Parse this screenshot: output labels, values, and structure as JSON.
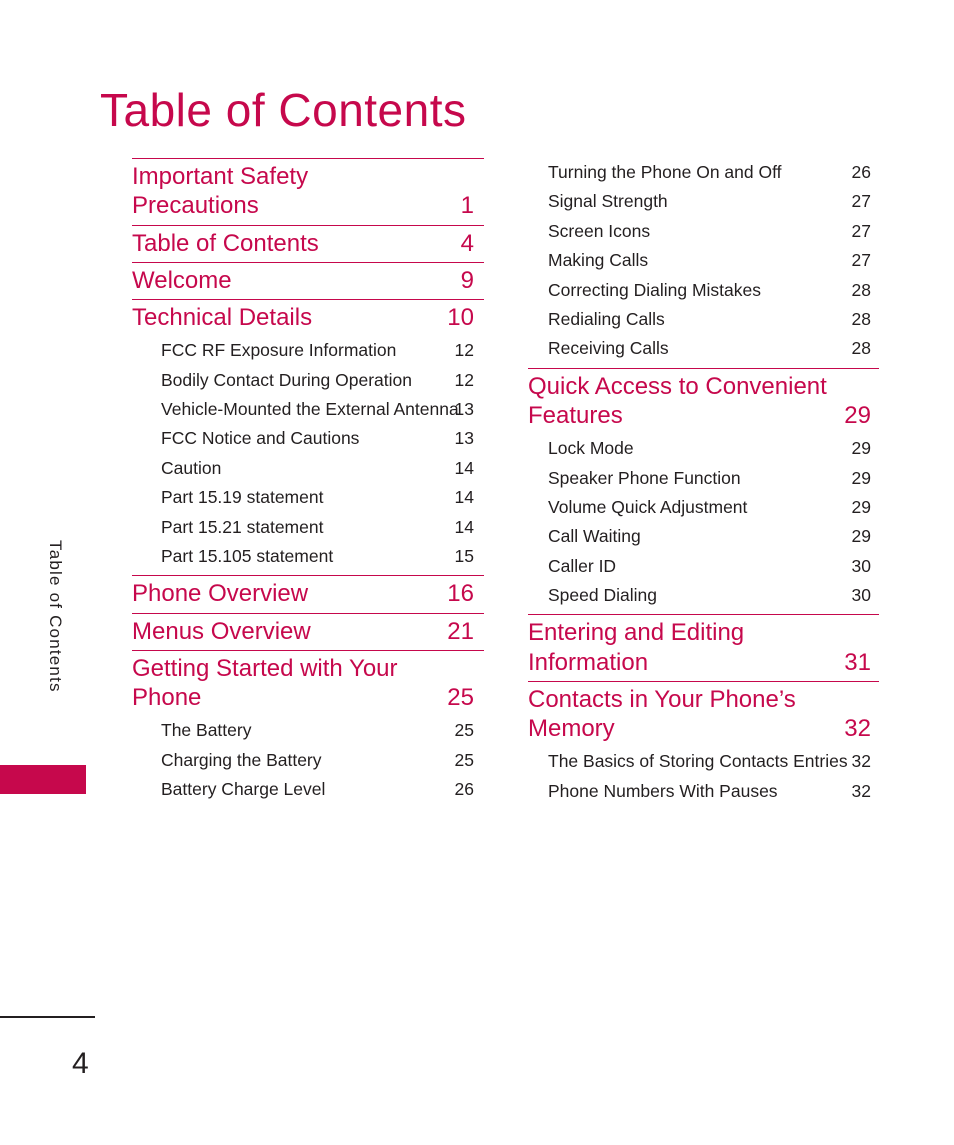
{
  "document": {
    "title": "Table of Contents",
    "page_number": "4",
    "side_tab_label": "Table of Contents",
    "accent_color": "#c6084c",
    "text_color": "#231f20"
  },
  "columns": [
    {
      "id": "left",
      "blocks": [
        {
          "kind": "major",
          "label": "Important Safety Precautions",
          "page": "1"
        },
        {
          "kind": "major",
          "label": "Table of Contents",
          "page": "4"
        },
        {
          "kind": "major",
          "label": "Welcome",
          "page": "9"
        },
        {
          "kind": "major",
          "label": "Technical Details",
          "page": "10"
        },
        {
          "kind": "sub-group",
          "items": [
            {
              "label": "FCC RF Exposure Information",
              "page": "12"
            },
            {
              "label": "Bodily Contact During Operation",
              "page": "12"
            },
            {
              "label": "Vehicle-Mounted the External Antenna",
              "page": "13"
            },
            {
              "label": "FCC Notice and Cautions",
              "page": "13"
            },
            {
              "label": "Caution",
              "page": "14"
            },
            {
              "label": "Part 15.19 statement",
              "page": "14"
            },
            {
              "label": "Part 15.21 statement",
              "page": "14"
            },
            {
              "label": "Part 15.105 statement",
              "page": "15"
            }
          ]
        },
        {
          "kind": "major",
          "label": "Phone Overview",
          "page": "16"
        },
        {
          "kind": "major",
          "label": "Menus Overview",
          "page": "21"
        },
        {
          "kind": "major",
          "label": "Getting Started with Your Phone",
          "page": "25"
        },
        {
          "kind": "sub-group",
          "items": [
            {
              "label": "The Battery",
              "page": "25"
            },
            {
              "label": "Charging the Battery",
              "page": "25"
            },
            {
              "label": "Battery Charge Level",
              "page": "26"
            }
          ]
        }
      ]
    },
    {
      "id": "right",
      "blocks": [
        {
          "kind": "sub-group",
          "items": [
            {
              "label": "Turning the Phone On and Off",
              "page": "26"
            },
            {
              "label": "Signal Strength",
              "page": "27"
            },
            {
              "label": "Screen Icons",
              "page": "27"
            },
            {
              "label": "Making Calls",
              "page": "27"
            },
            {
              "label": "Correcting Dialing Mistakes",
              "page": "28"
            },
            {
              "label": "Redialing Calls",
              "page": "28"
            },
            {
              "label": "Receiving Calls",
              "page": "28"
            }
          ]
        },
        {
          "kind": "major",
          "label": "Quick Access to Convenient Features",
          "page": "29"
        },
        {
          "kind": "sub-group",
          "items": [
            {
              "label": "Lock Mode",
              "page": "29"
            },
            {
              "label": "Speaker Phone Function",
              "page": "29"
            },
            {
              "label": "Volume Quick Adjustment",
              "page": "29"
            },
            {
              "label": "Call Waiting",
              "page": "29"
            },
            {
              "label": "Caller ID",
              "page": "30"
            },
            {
              "label": "Speed Dialing",
              "page": "30"
            }
          ]
        },
        {
          "kind": "major",
          "label": "Entering and Editing Information",
          "page": "31"
        },
        {
          "kind": "major",
          "label": "Contacts in Your Phone’s Memory",
          "page": "32"
        },
        {
          "kind": "sub-group",
          "items": [
            {
              "label": "The Basics of Storing Contacts Entries",
              "page": "32"
            },
            {
              "label": "Phone Numbers With Pauses",
              "page": "32"
            }
          ]
        }
      ]
    }
  ]
}
